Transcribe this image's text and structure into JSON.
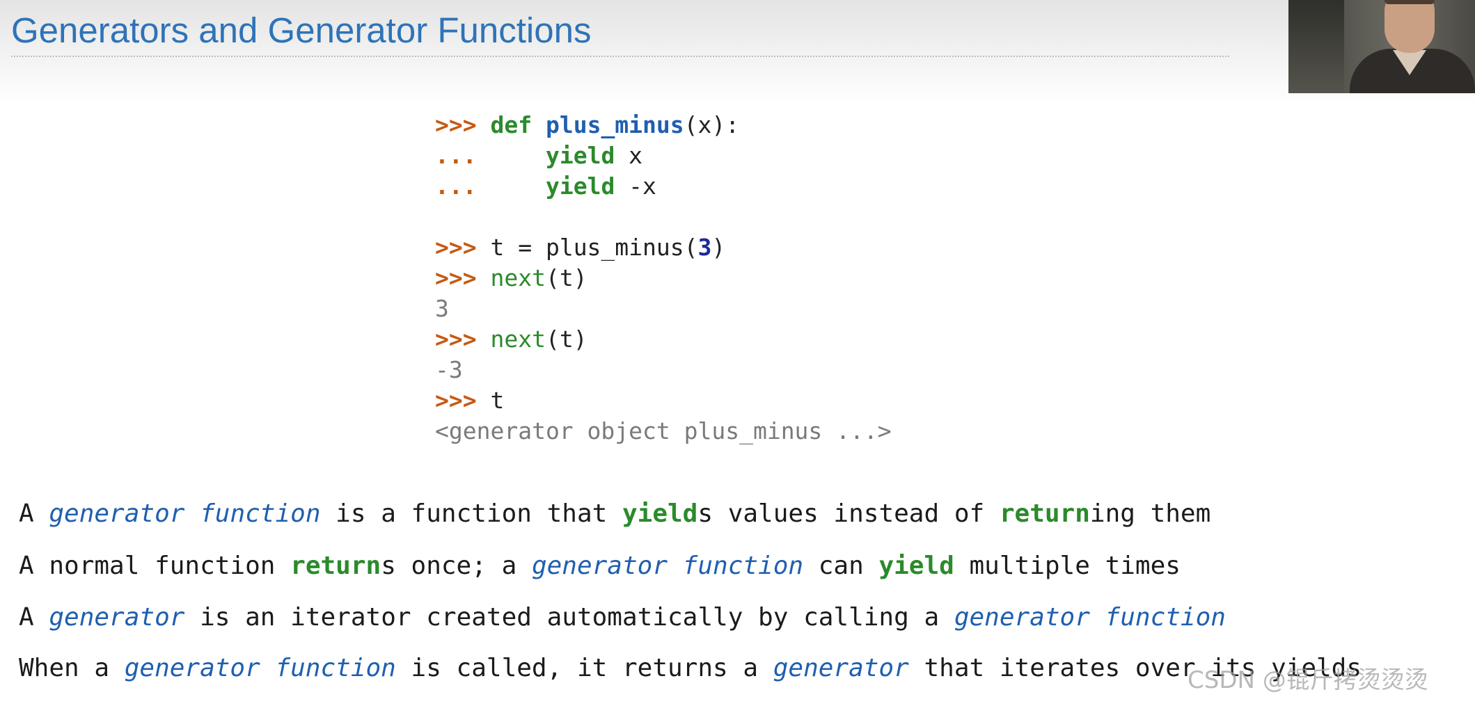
{
  "slide": {
    "title": "Generators and Generator Functions"
  },
  "code": {
    "prompt": ">>>",
    "continuation": "...",
    "lines": [
      {
        "kw": "def",
        "fn": "plus_minus",
        "rest": "(x):"
      },
      {
        "indent": "    ",
        "kw": "yield",
        "rest": " x"
      },
      {
        "indent": "    ",
        "kw": "yield",
        "rest": " -x"
      },
      {
        "text_a": "t = plus_minus(",
        "num": "3",
        "text_b": ")"
      },
      {
        "builtin": "next",
        "rest": "(t)"
      },
      {
        "output": "3"
      },
      {
        "builtin": "next",
        "rest": "(t)"
      },
      {
        "output": "-3"
      },
      {
        "rest": "t"
      },
      {
        "output": "<generator object plus_minus ...>"
      }
    ]
  },
  "bullets": [
    {
      "a": "A ",
      "term1": "generator function",
      "b": " is a function that ",
      "hl1": "yield",
      "c": "s values instead of ",
      "hl2": "return",
      "d": "ing them"
    },
    {
      "a": "A normal function ",
      "hl1": "return",
      "b": "s once; a ",
      "term1": "generator function",
      "c": " can ",
      "hl2": "yield",
      "d": " multiple times"
    },
    {
      "a": "A ",
      "term1": "generator",
      "b": " is an iterator created automatically by calling a ",
      "term2": "generator function"
    },
    {
      "a": "When a ",
      "term1": "generator function",
      "b": " is called, it returns a ",
      "term2": "generator",
      "c": " that iterates over its yields"
    }
  ],
  "watermark": {
    "text": "CSDN @锟斤拷烫烫烫"
  },
  "colors": {
    "title": "#2e73b8",
    "prompt": "#c55a11",
    "keyword": "#2b8a2b",
    "function_name": "#1f5fb0",
    "number": "#1c2a9c",
    "output": "#7a7a7a",
    "term": "#1f5fb0"
  }
}
